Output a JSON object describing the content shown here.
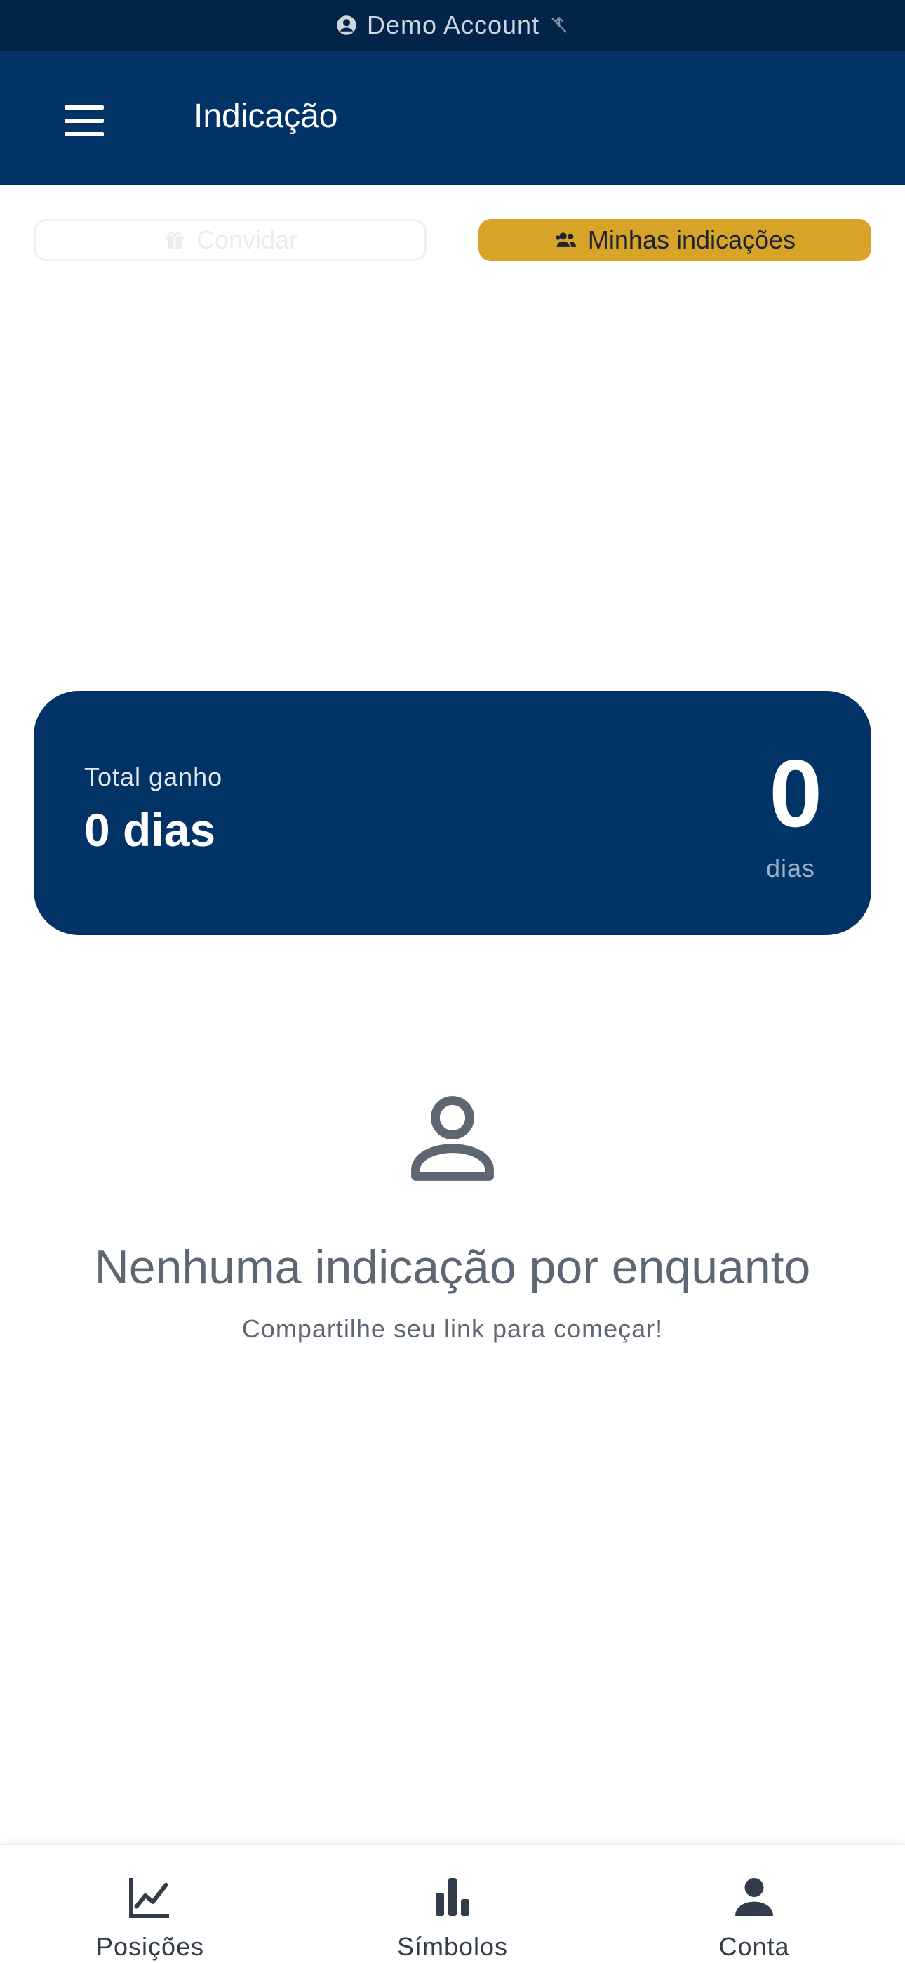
{
  "status_bar": {
    "account_label": "Demo Account",
    "account_icon": "account-circle-icon",
    "signal_icon": "signal-off-icon"
  },
  "header": {
    "title": "Indicação",
    "menu_icon": "hamburger-menu-icon"
  },
  "tabs": [
    {
      "label": "Convidar",
      "icon": "gift-icon",
      "active": false
    },
    {
      "label": "Minhas indicações",
      "icon": "people-icon",
      "active": true
    }
  ],
  "summary": {
    "label": "Total ganho",
    "value": "0 dias",
    "big_number": "0",
    "unit": "dias"
  },
  "empty_state": {
    "icon": "person-outline-icon",
    "title": "Nenhuma indicação por enquanto",
    "subtitle": "Compartilhe seu link para começar!"
  },
  "bottom_nav": [
    {
      "label": "Posições",
      "icon": "line-chart-icon"
    },
    {
      "label": "Símbolos",
      "icon": "bar-chart-icon"
    },
    {
      "label": "Conta",
      "icon": "person-icon"
    }
  ],
  "colors": {
    "header_bg": "#023366",
    "status_bg": "#022449",
    "accent": "#d8a427",
    "muted_text": "#5d6673"
  }
}
